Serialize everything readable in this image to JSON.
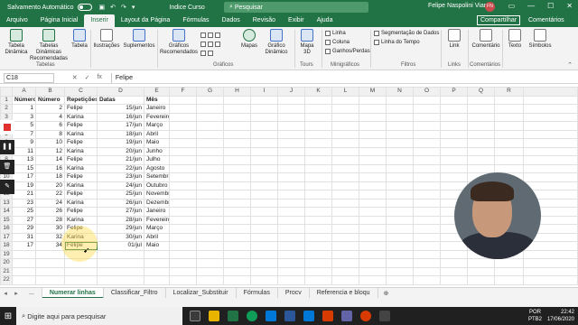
{
  "titlebar": {
    "autosave_label": "Salvamento Automático",
    "doc_title": "Indice Curso",
    "search_placeholder": "Pesquisar",
    "user_name": "Felipe Naspolini Viante",
    "user_initials": "FN"
  },
  "menu": {
    "tabs": [
      "Arquivo",
      "Página Inicial",
      "Inserir",
      "Layout da Página",
      "Fórmulas",
      "Dados",
      "Revisão",
      "Exibir",
      "Ajuda"
    ],
    "active_tab": "Inserir",
    "share_label": "Compartilhar",
    "comments_label": "Comentários"
  },
  "ribbon": {
    "buttons": {
      "pivot": "Tabela Dinâmica",
      "rec_pivot": "Tabelas Dinâmicas Recomendadas",
      "table": "Tabela",
      "illustrations": "Ilustrações",
      "addins": "Suplementos",
      "rec_charts": "Gráficos Recomendados",
      "maps": "Mapas",
      "pivot_chart": "Gráfico Dinâmico",
      "map3d": "Mapa 3D",
      "line": "Linha",
      "column": "Coluna",
      "winloss": "Ganhos/Perdas",
      "slicer": "Segmentação de Dados",
      "timeline": "Linha do Tempo",
      "link": "Link",
      "comment": "Comentário",
      "text": "Texto",
      "symbols": "Símbolos"
    },
    "groups": {
      "tables": "Tabelas",
      "charts": "Gráficos",
      "tours": "Tours",
      "sparklines": "Minigráficos",
      "filters": "Filtros",
      "links": "Links",
      "comments": "Comentários"
    }
  },
  "formula": {
    "name_box": "C18",
    "value": "Felipe",
    "fx": "fx"
  },
  "grid": {
    "columns": [
      "A",
      "B",
      "C",
      "D",
      "E",
      "F",
      "G",
      "H",
      "I",
      "J",
      "K",
      "L",
      "M",
      "N",
      "O",
      "P",
      "Q",
      "R"
    ],
    "headers": [
      "Número",
      "Número",
      "Repetições",
      "Datas",
      "Mês"
    ],
    "rows": [
      [
        "1",
        "2",
        "Felipe",
        "15/jun",
        "Janeiro"
      ],
      [
        "3",
        "4",
        "Karina",
        "16/jun",
        "Fevereiro"
      ],
      [
        "5",
        "6",
        "Felipe",
        "17/jun",
        "Março"
      ],
      [
        "7",
        "8",
        "Karina",
        "18/jun",
        "Abril"
      ],
      [
        "9",
        "10",
        "Felipe",
        "19/jun",
        "Maio"
      ],
      [
        "11",
        "12",
        "Karina",
        "20/jun",
        "Junho"
      ],
      [
        "13",
        "14",
        "Felipe",
        "21/jun",
        "Julho"
      ],
      [
        "15",
        "16",
        "Karina",
        "22/jun",
        "Agosto"
      ],
      [
        "17",
        "18",
        "Felipe",
        "23/jun",
        "Setembro"
      ],
      [
        "19",
        "20",
        "Karina",
        "24/jun",
        "Outubro"
      ],
      [
        "21",
        "22",
        "Felipe",
        "25/jun",
        "Novembro"
      ],
      [
        "23",
        "24",
        "Karina",
        "26/jun",
        "Dezembro"
      ],
      [
        "25",
        "26",
        "Felipe",
        "27/jun",
        "Janeiro"
      ],
      [
        "27",
        "28",
        "Karina",
        "28/jun",
        "Fevereiro"
      ],
      [
        "29",
        "30",
        "Felipe",
        "29/jun",
        "Março"
      ],
      [
        "31",
        "32",
        "Karina",
        "30/jun",
        "Abril"
      ],
      [
        "17",
        "34",
        "Felipe",
        "01/jul",
        "Maio"
      ]
    ],
    "row_numbers": [
      "1",
      "2",
      "3",
      "4",
      "5",
      "6",
      "7",
      "8",
      "9",
      "10",
      "11",
      "12",
      "13",
      "14",
      "15",
      "16",
      "17",
      "18",
      "19",
      "20",
      "21",
      "22"
    ]
  },
  "sheets": {
    "tabs": [
      "...",
      "Numerar linhas",
      "Classificar_Filtro",
      "Localizar_Substituir",
      "Fórmulas",
      "Procv",
      "Referencia e bloqu"
    ],
    "active": "Numerar linhas"
  },
  "taskbar": {
    "search_placeholder": "Digite aqui para pesquisar",
    "lang": "POR",
    "lang2": "PTB2",
    "time": "22:42",
    "date": "17/06/2020"
  }
}
